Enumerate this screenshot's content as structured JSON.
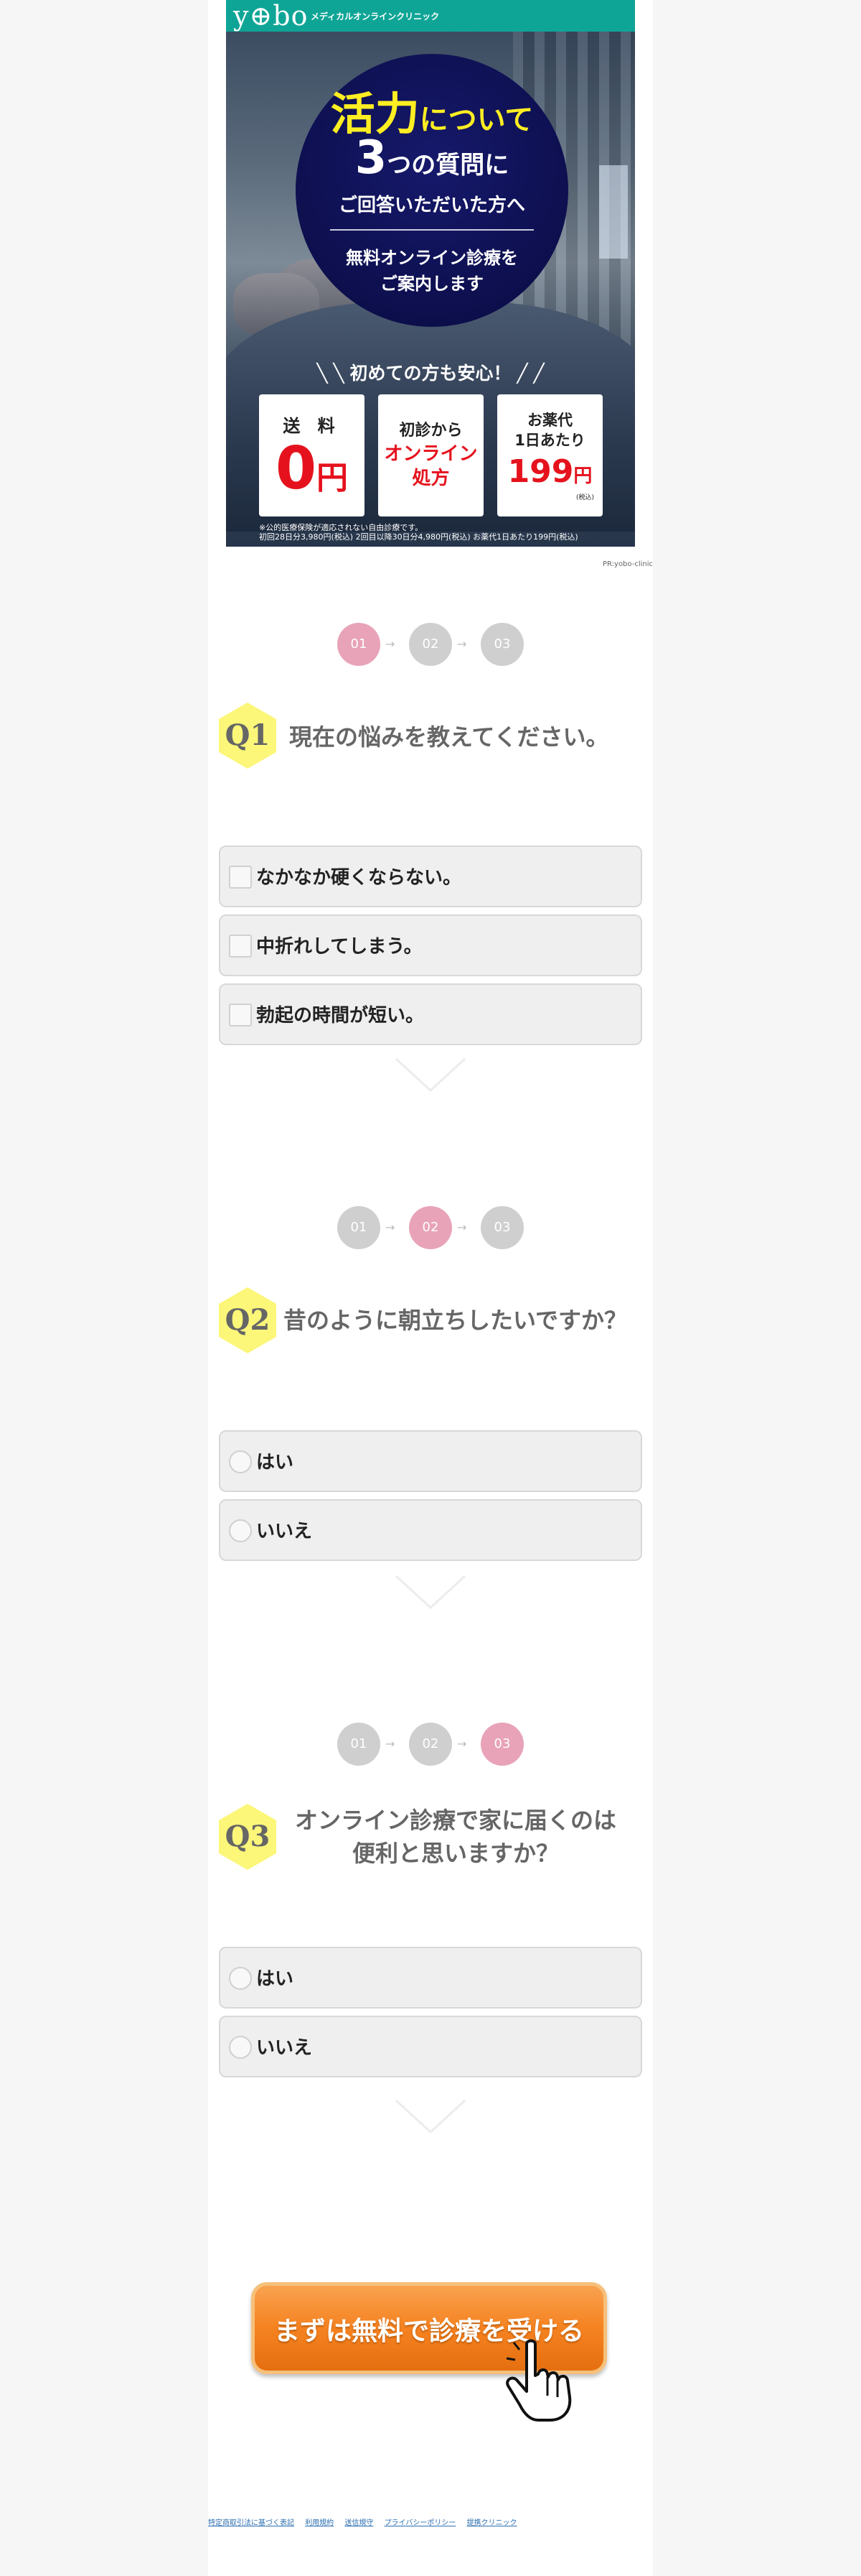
{
  "hero": {
    "logo": "y⊕bo",
    "logo_sub": "メディカルオンラインクリニック",
    "circle": {
      "line1_big": "活力",
      "line1_rest": "について",
      "line2_big": "3",
      "line2_rest": "つの質問に",
      "line3": "ご回答いただいた方へ",
      "line4a": "無料オンライン診療を",
      "line4b": "ご案内します"
    },
    "reassure": "初めての方も安心！",
    "box1": {
      "top": "送 料",
      "num": "0",
      "unit": "円"
    },
    "box2": {
      "top": "初診から",
      "red1": "オンライン",
      "red2": "処方"
    },
    "box3": {
      "top1": "お薬代",
      "top2": "1日あたり",
      "num": "199",
      "unit": "円",
      "tax": "(税込)"
    },
    "note1": "※公的医療保険が適応されない自由診療です。",
    "note2": "初回28日分3,980円(税込)  2回目以降30日分4,980円(税込)  お薬代1日あたり199円(税込)",
    "pr": "PR:yobo-clinic"
  },
  "steps": [
    "01",
    "02",
    "03"
  ],
  "step_arrow": "→",
  "q1": {
    "badge": "Q1",
    "title": "現在の悩みを教えてください。",
    "options": [
      "なかなか硬くならない。",
      "中折れしてしまう。",
      "勃起の時間が短い。"
    ]
  },
  "q2": {
    "badge": "Q2",
    "title": "昔のように朝立ちしたいですか？",
    "options": [
      "はい",
      "いいえ"
    ]
  },
  "q3": {
    "badge": "Q3",
    "title_line1": "オンライン診療で家に届くのは",
    "title_line2": "便利と思いますか？",
    "options": [
      "はい",
      "いいえ"
    ]
  },
  "cta": {
    "label": "まずは無料で診療を受ける"
  },
  "footer": {
    "links": [
      "特定商取引法に基づく表記",
      "利用規約",
      "送信規守",
      "プライバシーポリシー",
      "提携クリニック"
    ]
  },
  "colors": {
    "brand": "#0fa596",
    "step_active": "#e8a3b8",
    "cta": "#f58220",
    "badge": "#fcf679"
  }
}
